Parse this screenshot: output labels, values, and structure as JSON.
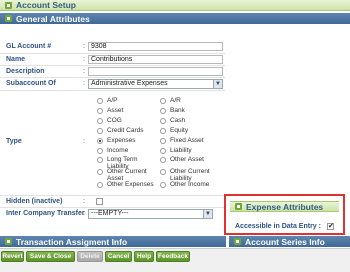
{
  "window": {
    "title": "Account Setup"
  },
  "general": {
    "title": "General Attributes",
    "gl_account_label": "GL Account #",
    "gl_account_value": "9308",
    "name_label": "Name",
    "name_value": "Contributions",
    "description_label": "Description",
    "description_value": "",
    "subaccount_label": "Subaccount Of",
    "subaccount_value": "Administrative Expenses",
    "type_label": "Type",
    "colon": ":",
    "type_left": [
      {
        "label": "A/P",
        "selected": false
      },
      {
        "label": "Asset",
        "selected": false
      },
      {
        "label": "COG",
        "selected": false
      },
      {
        "label": "Credit Cards",
        "selected": false
      },
      {
        "label": "Expenses",
        "selected": true
      },
      {
        "label": "Income",
        "selected": false
      },
      {
        "label": "Long Term Liability",
        "selected": false
      },
      {
        "label": "Other Current Asset",
        "selected": false
      },
      {
        "label": "Other Expenses",
        "selected": false
      }
    ],
    "type_right": [
      {
        "label": "A/R",
        "selected": false
      },
      {
        "label": "Bank",
        "selected": false
      },
      {
        "label": "Cash",
        "selected": false
      },
      {
        "label": "Equity",
        "selected": false
      },
      {
        "label": "Fixed Asset",
        "selected": false
      },
      {
        "label": "Liability",
        "selected": false
      },
      {
        "label": "Other Asset",
        "selected": false
      },
      {
        "label": "Other Current Liability",
        "selected": false
      },
      {
        "label": "Other Income",
        "selected": false
      }
    ],
    "hidden_label": "Hidden (inactive)",
    "intercompany_label": "Inter Company Transfer",
    "intercompany_value": "---EMPTY---"
  },
  "expense": {
    "title": "Expense Attributes",
    "accessible_label": "Accessible in Data Entry :",
    "accessible_checked": true
  },
  "transaction": {
    "title": "Transaction Assigment Info"
  },
  "account_series": {
    "title": "Account Series Info"
  },
  "buttons": {
    "revert": "Revert",
    "save_close": "Save & Close",
    "delete": "Delete",
    "cancel": "Cancel",
    "help": "Help",
    "feedback": "Feedback"
  }
}
